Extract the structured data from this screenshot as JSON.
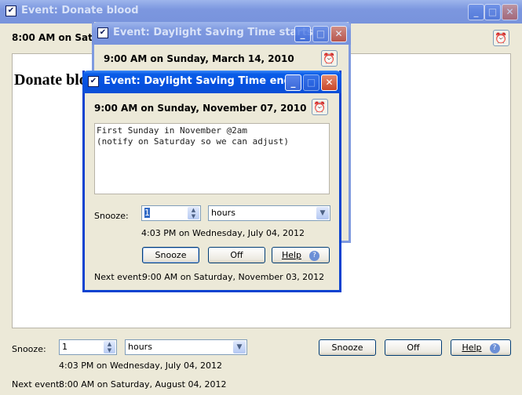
{
  "main_window": {
    "title": "Event: Donate blood",
    "datetime": "8:00 AM on Saturday, August 04, 2012",
    "heading": "Donate blood",
    "snooze_label": "Snooze:",
    "snooze_value": "1",
    "snooze_unit": "hours",
    "snooze_until": "4:03 PM on Wednesday, July 04, 2012",
    "buttons": {
      "snooze": "Snooze",
      "off": "Off",
      "help": "Help"
    },
    "next_event_label": "Next event:",
    "next_event": "8:00 AM on Saturday, August 04, 2012"
  },
  "window_dst_starts": {
    "title": "Event: Daylight Saving Time starts",
    "datetime": "9:00 AM on Sunday, March 14, 2010"
  },
  "window_dst_ends": {
    "title": "Event: Daylight Saving Time ends",
    "datetime": "9:00 AM on Sunday, November 07, 2010",
    "notes_line1": "First Sunday in November @2am",
    "notes_line2": "(notify on Saturday so we can adjust)",
    "snooze_label": "Snooze:",
    "snooze_value": "1",
    "snooze_unit": "hours",
    "snooze_until": "4:03 PM on Wednesday, July 04, 2012",
    "buttons": {
      "snooze": "Snooze",
      "off": "Off",
      "help": "Help"
    },
    "next_event_label": "Next event:",
    "next_event": "9:00 AM on Saturday, November 03, 2012"
  },
  "icons": {
    "title": "checkbox-icon",
    "clock": "alarm-clock-icon",
    "help": "help-icon"
  },
  "colors": {
    "active_title": "#0551e0",
    "inactive_title": "#7c97df",
    "window_bg": "#ece9d8"
  }
}
